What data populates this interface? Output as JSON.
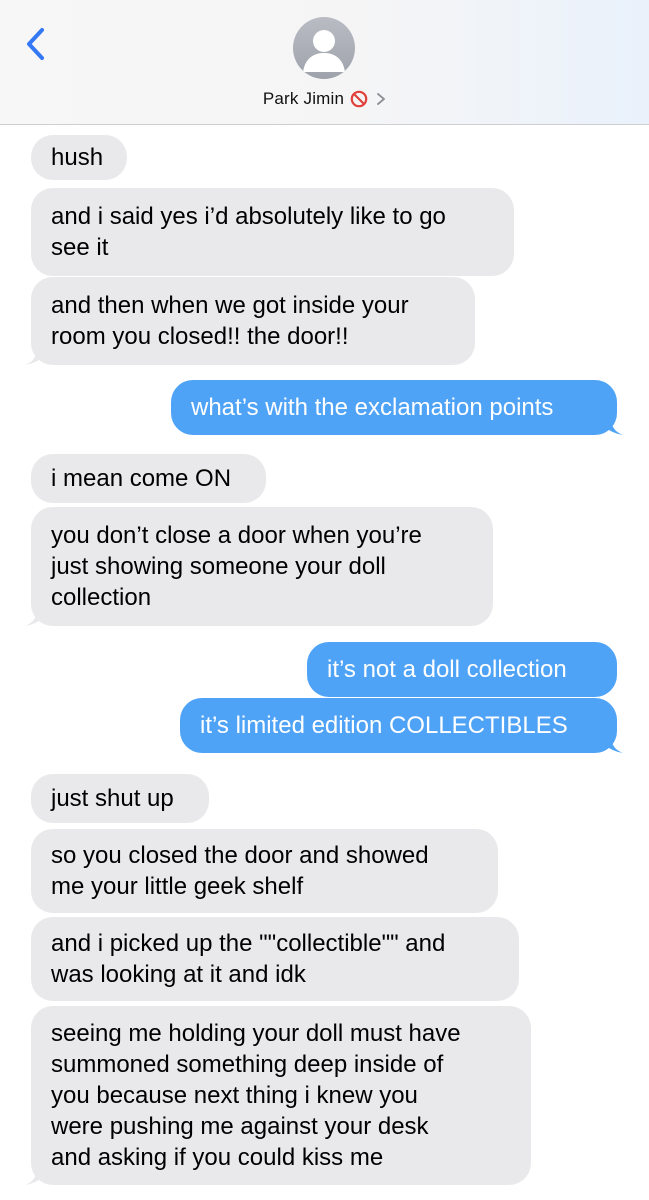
{
  "header": {
    "contact_name": "Park Jimin",
    "back_icon": "chevron-left-icon",
    "avatar_icon": "person-silhouette-icon",
    "blocked_icon": "no-entry-icon",
    "disclosure_icon": "chevron-right-icon",
    "accent_color": "#3478f6"
  },
  "colors": {
    "incoming_bubble": "#e9e9eb",
    "outgoing_bubble": "#4fa3f7",
    "blocked_red": "#e0413a"
  },
  "messages": [
    {
      "from": "them",
      "lines": [
        "hush"
      ]
    },
    {
      "from": "them",
      "lines": [
        "and i said yes i’d absolutely like to go",
        "see it"
      ]
    },
    {
      "from": "them",
      "lines": [
        "and then when we got inside your",
        "room you closed!! the door!!"
      ]
    },
    {
      "from": "me",
      "lines": [
        "what’s with the exclamation points"
      ]
    },
    {
      "from": "them",
      "lines": [
        "i mean come ON"
      ]
    },
    {
      "from": "them",
      "lines": [
        "you don’t close a door when you’re",
        "just showing someone your doll",
        "collection"
      ]
    },
    {
      "from": "me",
      "lines": [
        "it’s not a doll collection"
      ]
    },
    {
      "from": "me",
      "lines": [
        "it’s limited edition COLLECTIBLES"
      ]
    },
    {
      "from": "them",
      "lines": [
        "just shut up"
      ]
    },
    {
      "from": "them",
      "lines": [
        "so you closed the door and showed",
        "me your little geek shelf"
      ]
    },
    {
      "from": "them",
      "lines": [
        "and i picked up the \"\"collectible\"\" and",
        "was looking at it and idk"
      ]
    },
    {
      "from": "them",
      "lines": [
        "seeing me holding your doll must have",
        "summoned something deep inside of",
        "you because next thing i knew you",
        "were pushing me against your desk",
        "and asking if you could kiss me"
      ]
    }
  ]
}
